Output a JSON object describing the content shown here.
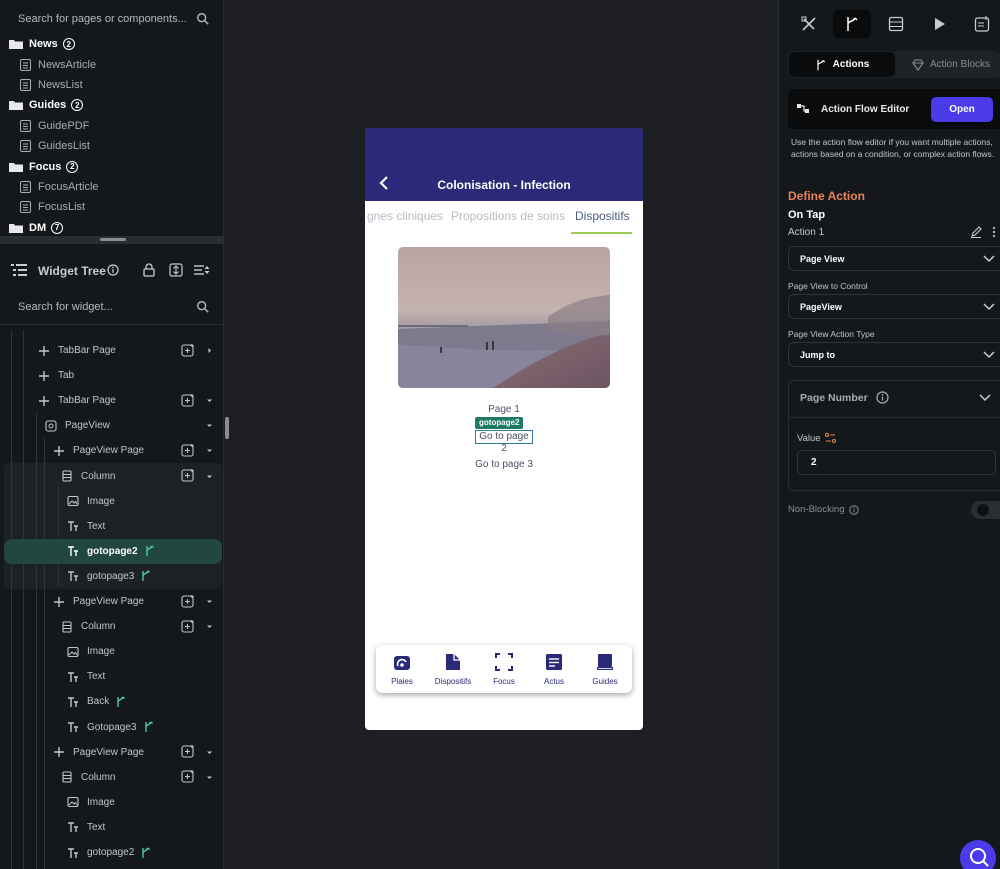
{
  "left_panel": {
    "page_search_placeholder": "Search for pages or components...",
    "folders": [
      {
        "name": "News",
        "count": "2",
        "pages": [
          "NewsArticle",
          "NewsList"
        ]
      },
      {
        "name": "Guides",
        "count": "2",
        "pages": [
          "GuidePDF",
          "GuidesList"
        ]
      },
      {
        "name": "Focus",
        "count": "2",
        "pages": [
          "FocusArticle",
          "FocusList"
        ]
      },
      {
        "name": "DM",
        "count": "7",
        "pages": []
      }
    ],
    "widget_tree_title": "Widget Tree",
    "widget_search_placeholder": "Search for widget...",
    "tree": [
      "TabBar Page",
      "Tab",
      "TabBar Page",
      "PageView",
      "PageView Page",
      "Column",
      "Image",
      "Text",
      "gotopage2",
      "gotopage3",
      "PageView Page",
      "Column",
      "Image",
      "Text",
      "Back",
      "Gotopage3",
      "PageView Page",
      "Column",
      "Image",
      "Text",
      "gotopage2"
    ]
  },
  "phone": {
    "app_title": "Colonisation - Infection",
    "tabs": [
      "gnes cliniques",
      "Propositions de soins",
      "Dispositifs"
    ],
    "active_tab": "Dispositifs",
    "page_label": "Page 1",
    "selected_tag": "gotopage2",
    "link_page2": "Go to page 2",
    "link_page3": "Go to page 3",
    "nav_items": [
      {
        "label": "Plaies",
        "icon": "bandage-icon"
      },
      {
        "label": "Dispositifs",
        "icon": "document-icon"
      },
      {
        "label": "Focus",
        "icon": "focus-icon"
      },
      {
        "label": "Actus",
        "icon": "news-icon"
      },
      {
        "label": "Guides",
        "icon": "book-icon"
      }
    ],
    "brand_color": "#2a2a78"
  },
  "right_panel": {
    "tab_actions": "Actions",
    "tab_action_blocks": "Action Blocks",
    "flow_editor_label": "Action Flow Editor",
    "open_button": "Open",
    "help_text": "Use the action flow editor if you want multiple actions, actions based on a condition, or complex action flows.",
    "define_action": "Define Action",
    "trigger": "On Tap",
    "action_name": "Action 1",
    "action_type": "Page View",
    "control_label": "Page View to Control",
    "control_value": "PageView",
    "action_type_label": "Page View Action Type",
    "action_type_value": "Jump to",
    "page_number_label": "Page Number",
    "value_label": "Value",
    "value": "2",
    "non_blocking_label": "Non-Blocking",
    "accent_color": "#4b3bea",
    "define_color": "#e98259"
  }
}
